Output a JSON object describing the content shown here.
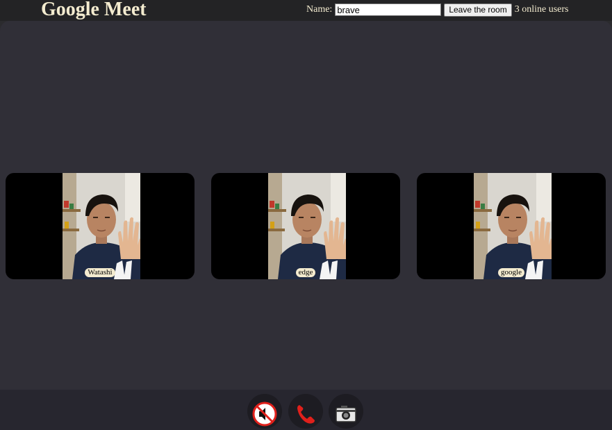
{
  "header": {
    "title": "Google Meet",
    "name_label": "Name:",
    "name_value": "brave",
    "leave_label": "Leave the room",
    "online_text": "3 online users"
  },
  "participants": [
    {
      "name": "Watashi"
    },
    {
      "name": "edge"
    },
    {
      "name": "google"
    }
  ],
  "controls": {
    "mute_icon": "muted-speaker-icon",
    "hangup_icon": "phone-icon",
    "camera_icon": "camera-icon"
  },
  "colors": {
    "accent_text": "#f3ebcf",
    "stage_bg": "#302f37",
    "hangup_red": "#e0201b"
  }
}
